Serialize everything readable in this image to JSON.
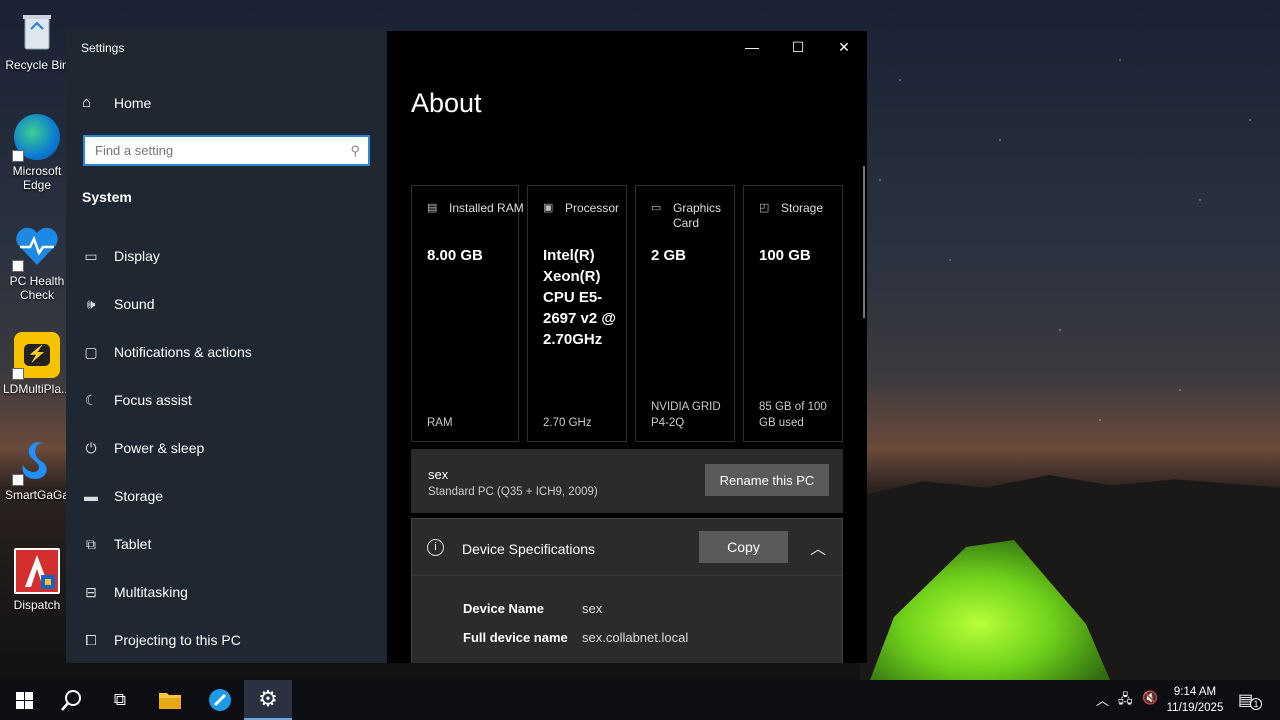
{
  "desktop": {
    "icons": [
      {
        "label": "Recycle Bin",
        "icon": "recycle-bin-icon"
      },
      {
        "label": "Microsoft Edge",
        "icon": "edge-icon"
      },
      {
        "label": "PC Health Check",
        "icon": "pc-health-icon"
      },
      {
        "label": "LDMultiPla...",
        "icon": "ldmultiplayer-icon"
      },
      {
        "label": "SmartGaGa",
        "icon": "smartgaga-icon"
      },
      {
        "label": "Dispatch",
        "icon": "dispatch-icon"
      }
    ]
  },
  "window": {
    "title": "Settings",
    "controls": {
      "minimize": "—",
      "maximize": "☐",
      "close": "✕"
    }
  },
  "sidebar": {
    "home_label": "Home",
    "search_placeholder": "Find a setting",
    "section_title": "System",
    "items": [
      {
        "label": "Display",
        "icon": "monitor-icon"
      },
      {
        "label": "Sound",
        "icon": "speaker-icon"
      },
      {
        "label": "Notifications & actions",
        "icon": "notification-icon"
      },
      {
        "label": "Focus assist",
        "icon": "moon-icon"
      },
      {
        "label": "Power & sleep",
        "icon": "power-icon"
      },
      {
        "label": "Storage",
        "icon": "storage-icon"
      },
      {
        "label": "Tablet",
        "icon": "tablet-icon"
      },
      {
        "label": "Multitasking",
        "icon": "multitasking-icon"
      },
      {
        "label": "Projecting to this PC",
        "icon": "projecting-icon"
      }
    ]
  },
  "main": {
    "title": "About",
    "cards": [
      {
        "header": "Installed RAM",
        "value": "8.00 GB",
        "sub": "RAM",
        "icon": "ram-icon"
      },
      {
        "header": "Processor",
        "value": "Intel(R) Xeon(R) CPU E5-2697 v2 @ 2.70GHz",
        "sub": "2.70 GHz",
        "icon": "processor-icon"
      },
      {
        "header": "Graphics Card",
        "value": "2 GB",
        "sub": "NVIDIA GRID P4-2Q",
        "icon": "graphics-card-icon"
      },
      {
        "header": "Storage",
        "value": "100 GB",
        "sub": "85 GB of 100 GB used",
        "icon": "storage-disk-icon"
      }
    ],
    "pc": {
      "name": "sex",
      "model": "Standard PC (Q35 + ICH9, 2009)",
      "rename_label": "Rename this PC"
    },
    "specs": {
      "title": "Device Specifications",
      "copy_label": "Copy",
      "rows": [
        {
          "key": "Device Name",
          "value": "sex"
        },
        {
          "key": "Full device name",
          "value": "sex.collabnet.local"
        }
      ]
    }
  },
  "taskbar": {
    "time": "9:14 AM",
    "date": "11/19/2025",
    "notification_count": "1"
  }
}
